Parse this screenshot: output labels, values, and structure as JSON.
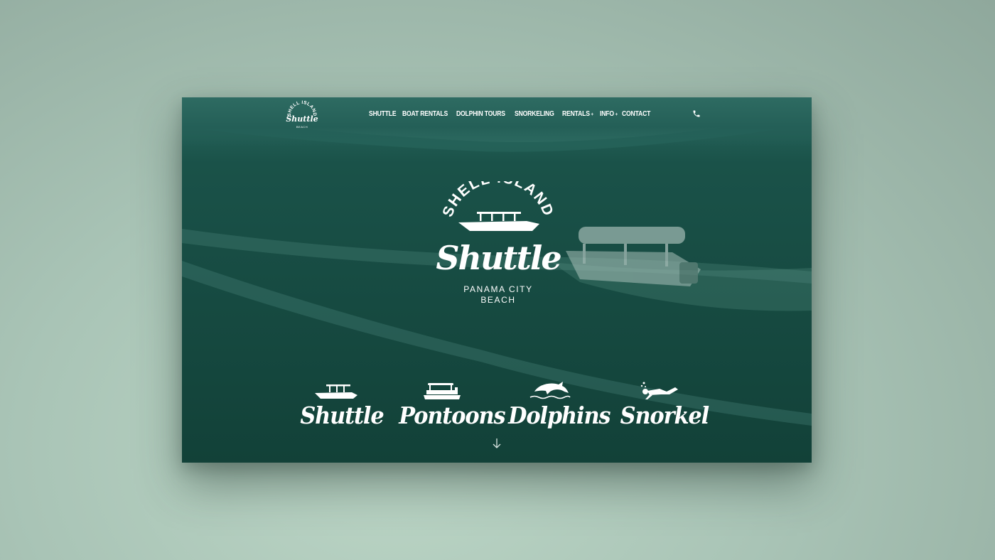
{
  "brand": {
    "nav_logo_top": "SHELL ISLAND",
    "nav_logo_script": "Shuttle",
    "nav_logo_bottom": "BEACH",
    "hero_logo_top": "SHELL ISLAND",
    "hero_logo_script": "Shuttle",
    "hero_logo_sub1": "PANAMA CITY",
    "hero_logo_sub2": "BEACH"
  },
  "nav": {
    "items": [
      {
        "label": "SHUTTLE"
      },
      {
        "label": "BOAT RENTALS"
      },
      {
        "label": "DOLPHIN TOURS"
      },
      {
        "label": "SNORKELING"
      },
      {
        "label": "RENTALS",
        "caret": "+"
      },
      {
        "label": "INFO",
        "caret": "+"
      },
      {
        "label": "CONTACT"
      }
    ],
    "phone_icon": "phone-icon"
  },
  "features": [
    {
      "label": "Shuttle",
      "icon": "shuttle-boat-icon"
    },
    {
      "label": "Pontoons",
      "icon": "pontoon-boat-icon"
    },
    {
      "label": "Dolphins",
      "icon": "dolphin-icon"
    },
    {
      "label": "Snorkel",
      "icon": "snorkeler-icon"
    }
  ],
  "colors": {
    "hero_overlay": "#14483f",
    "text": "#ffffff",
    "backdrop": "#b4cfc0"
  },
  "scroll_icon": "arrow-down-icon"
}
